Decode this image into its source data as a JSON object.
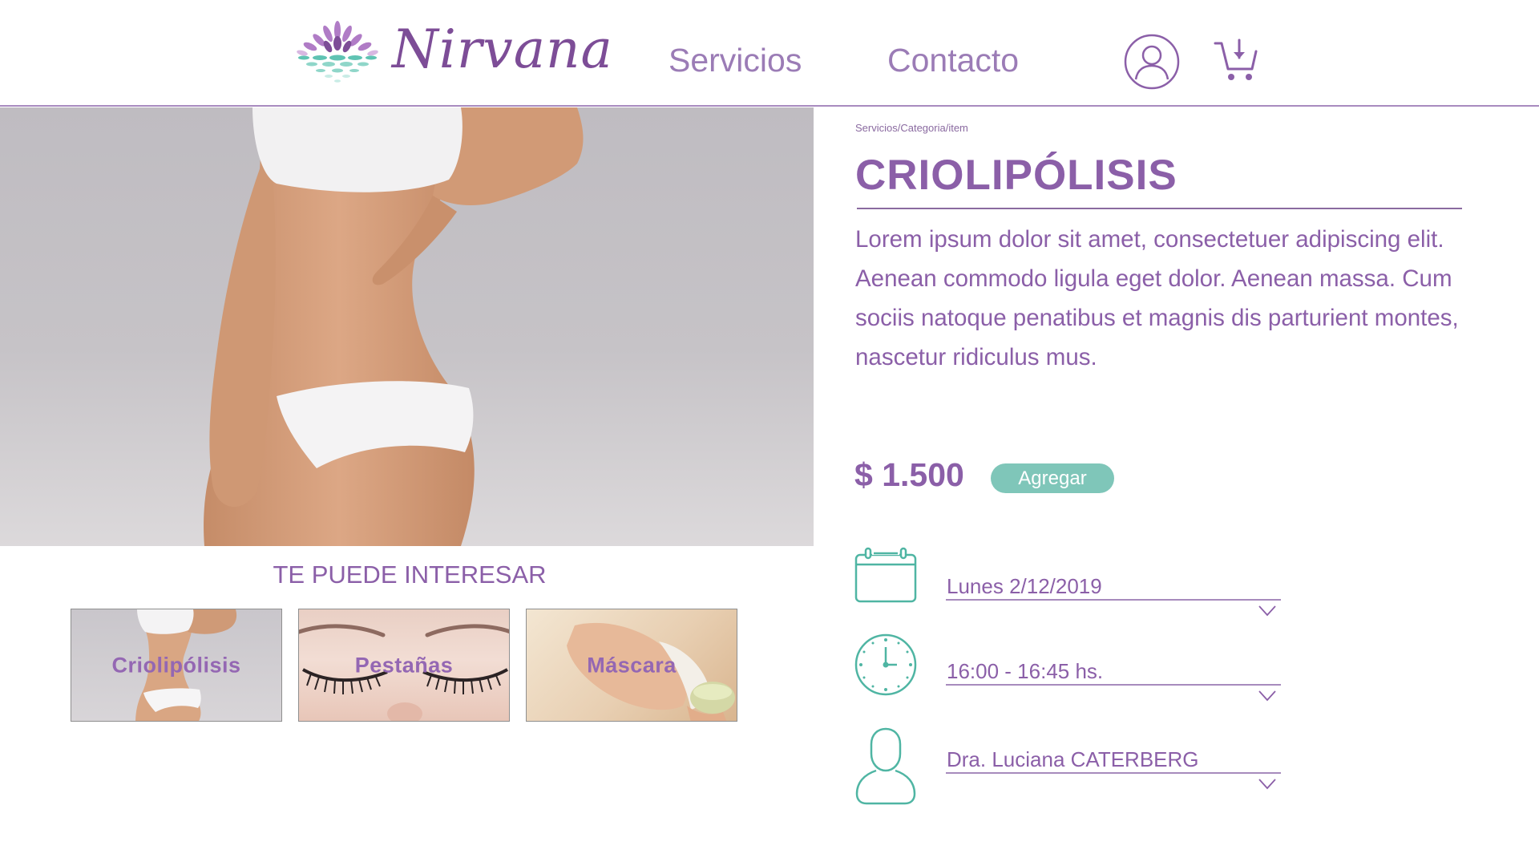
{
  "header": {
    "brand": "Nirvana",
    "nav": [
      {
        "label": "Servicios"
      },
      {
        "label": "Contacto"
      }
    ],
    "user_icon": "user-circle-icon",
    "cart_icon": "cart-download-icon"
  },
  "product": {
    "breadcrumb": "Servicios/Categoria/item",
    "title": "CRIOLIPÓLISIS",
    "description": "Lorem ipsum dolor sit amet, consectetuer adipiscing elit. Aenean commodo ligula eget dolor. Aenean massa. Cum sociis natoque penatibus et magnis dis parturient montes, nascetur ridiculus mus.",
    "price": "$ 1.500",
    "add_label": "Agregar"
  },
  "booking": {
    "date": {
      "value": "Lunes 2/12/2019",
      "icon": "calendar-icon"
    },
    "time": {
      "value": "16:00 - 16:45 hs.",
      "icon": "clock-icon"
    },
    "professional": {
      "value": "Dra. Luciana CATERBERG",
      "icon": "person-icon"
    }
  },
  "related": {
    "title": "TE PUEDE INTERESAR",
    "items": [
      {
        "label": "Criolipólisis"
      },
      {
        "label": "Pestañas"
      },
      {
        "label": "Máscara"
      }
    ]
  },
  "colors": {
    "purple": "#8b5fa8",
    "teal": "#7fc6b9",
    "icon_teal": "#4fb5a3"
  }
}
